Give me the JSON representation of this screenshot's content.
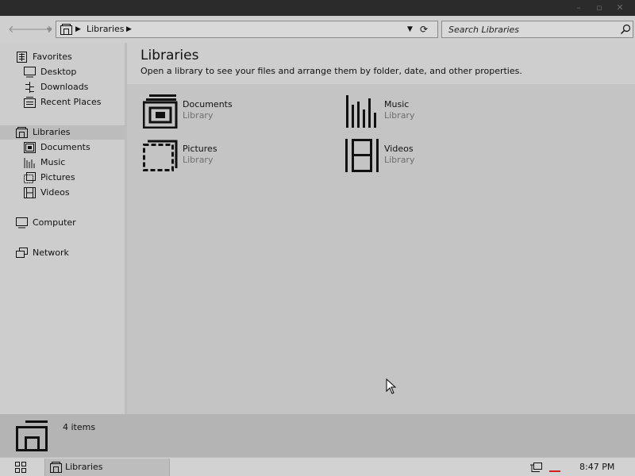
{
  "window": {
    "minimize_glyph": "–",
    "maximize_glyph": "▫",
    "close_glyph": "✕"
  },
  "nav": {
    "back_glyph": "🡐",
    "forward_glyph": "🡒",
    "recent_glyph": "▼",
    "address": {
      "icon": "library-icon",
      "separator": "▶",
      "segments": [
        "Libraries"
      ],
      "dropdown_glyph": "▼",
      "refresh_glyph": "⟳"
    },
    "search": {
      "placeholder": "Search Libraries",
      "icon": "search-icon"
    }
  },
  "sidebar": {
    "favorites": {
      "label": "Favorites",
      "icon": "star-icon",
      "items": [
        {
          "label": "Desktop",
          "icon": "desktop-icon"
        },
        {
          "label": "Downloads",
          "icon": "downloads-icon"
        },
        {
          "label": "Recent Places",
          "icon": "recent-places-icon"
        }
      ]
    },
    "libraries": {
      "label": "Libraries",
      "icon": "library-icon",
      "selected": true,
      "items": [
        {
          "label": "Documents",
          "icon": "documents-icon"
        },
        {
          "label": "Music",
          "icon": "music-icon"
        },
        {
          "label": "Pictures",
          "icon": "pictures-icon"
        },
        {
          "label": "Videos",
          "icon": "videos-icon"
        }
      ]
    },
    "computer": {
      "label": "Computer",
      "icon": "computer-icon"
    },
    "network": {
      "label": "Network",
      "icon": "network-icon"
    }
  },
  "main": {
    "title": "Libraries",
    "subtitle": "Open a library to see your files and arrange them by folder, date, and other properties.",
    "libraries": [
      {
        "name": "Documents",
        "type": "Library",
        "icon": "documents-icon"
      },
      {
        "name": "Music",
        "type": "Library",
        "icon": "music-icon"
      },
      {
        "name": "Pictures",
        "type": "Library",
        "icon": "pictures-icon"
      },
      {
        "name": "Videos",
        "type": "Library",
        "icon": "videos-icon"
      }
    ]
  },
  "details": {
    "count_text": "4 items",
    "icon": "library-icon"
  },
  "taskbar": {
    "start_icon": "start-grid-icon",
    "window_button": {
      "label": "Libraries",
      "icon": "library-icon"
    },
    "tray_icon": "network-tray-icon",
    "clock": "8:47 PM"
  },
  "colors": {
    "titlebar": "#2b2b2b",
    "selection": "#bcbcbc",
    "tray_alert": "#d02020",
    "secondary_text": "#6e6e6e"
  }
}
